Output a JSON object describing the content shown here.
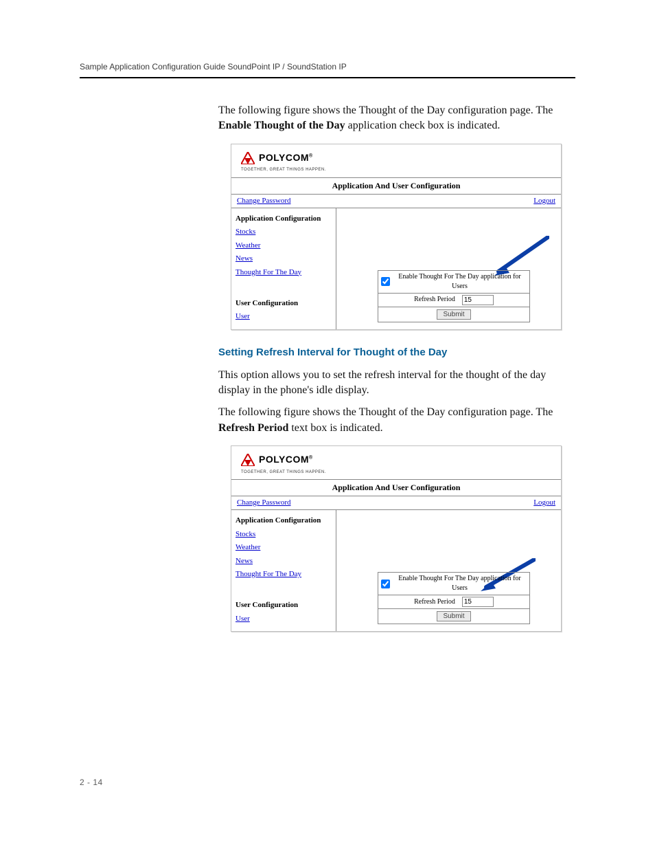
{
  "document": {
    "header_text": "Sample Application Configuration Guide SoundPoint IP / SoundStation IP",
    "page_number": "2 - 14",
    "intro_para_1_before": "The following figure shows the Thought of the Day configuration page. The ",
    "intro_para_1_bold": "Enable Thought of the Day",
    "intro_para_1_after": " application check box is indicated.",
    "section_heading": "Setting Refresh Interval for Thought of the Day",
    "section_para_1": "This option allows you to set the refresh interval for the thought of the day display in the phone's idle display.",
    "section_para_2_before": "The following figure shows the Thought of the Day configuration page. The ",
    "section_para_2_bold": "Refresh Period",
    "section_para_2_after": " text box is indicated."
  },
  "screenshot": {
    "brand_name": "POLYCOM",
    "brand_trademark": "®",
    "tagline": "TOGETHER, GREAT THINGS HAPPEN.",
    "title_bar": "Application And User Configuration",
    "toolbar": {
      "change_password": "Change Password",
      "logout": "Logout"
    },
    "sidebar": {
      "group_app_head": "Application Configuration",
      "items_app": [
        "Stocks",
        "Weather",
        "News",
        "Thought For The Day"
      ],
      "group_user_head": "User Configuration",
      "items_user": [
        "User"
      ]
    },
    "form": {
      "enable_label": "Enable Thought For The Day application for Users",
      "enable_checked": true,
      "refresh_label": "Refresh Period",
      "refresh_value": "15",
      "submit_label": "Submit"
    }
  }
}
